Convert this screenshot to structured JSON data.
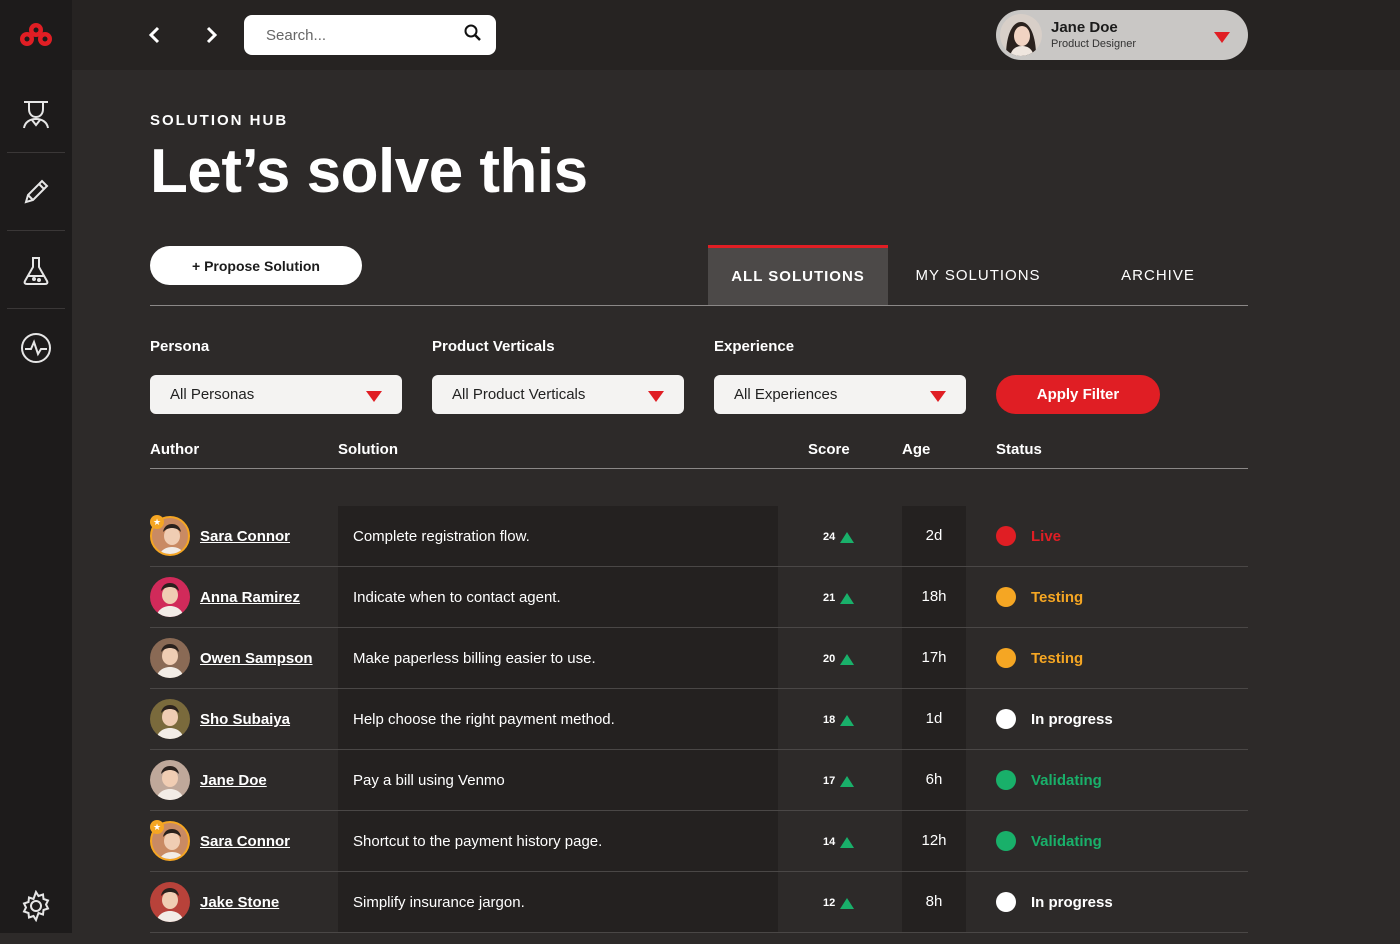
{
  "topbar": {
    "search_placeholder": "Search...",
    "user": {
      "name": "Jane Doe",
      "role": "Product Designer"
    }
  },
  "sidebar": {
    "items": [
      {
        "icon": "logo-icon"
      },
      {
        "icon": "persona-icon"
      },
      {
        "icon": "pencil-icon"
      },
      {
        "icon": "flask-icon"
      },
      {
        "icon": "pulse-icon"
      },
      {
        "icon": "gear-icon"
      }
    ]
  },
  "header": {
    "eyebrow": "SOLUTION HUB",
    "title": "Let’s solve this"
  },
  "actions": {
    "propose_label": "+ Propose Solution"
  },
  "tabs": [
    {
      "label": "ALL SOLUTIONS",
      "active": true
    },
    {
      "label": "MY SOLUTIONS",
      "active": false
    },
    {
      "label": "ARCHIVE",
      "active": false
    }
  ],
  "filters": {
    "persona": {
      "label": "Persona",
      "value": "All Personas"
    },
    "product": {
      "label": "Product Verticals",
      "value": "All Product Verticals"
    },
    "experience": {
      "label": "Experience",
      "value": "All Experiences"
    },
    "apply_label": "Apply Filter"
  },
  "table": {
    "headers": {
      "author": "Author",
      "solution": "Solution",
      "score": "Score",
      "age": "Age",
      "status": "Status"
    },
    "rows": [
      {
        "author": "Sara Connor",
        "solution": "Complete registration flow.",
        "score": "24",
        "age": "2d",
        "status": "Live",
        "status_color": "#e01e24",
        "dot_color": "#e01e24",
        "avatar_color": "#c98a63",
        "ring": "#f5a623",
        "starred": true
      },
      {
        "author": "Anna Ramirez",
        "solution": "Indicate when to contact agent.",
        "score": "21",
        "age": "18h",
        "status": "Testing",
        "status_color": "#f5a623",
        "dot_color": "#f5a623",
        "avatar_color": "#d12a5a",
        "ring": "",
        "starred": false
      },
      {
        "author": "Owen Sampson",
        "solution": "Make paperless billing easier to use.",
        "score": "20",
        "age": "17h",
        "status": "Testing",
        "status_color": "#f5a623",
        "dot_color": "#f5a623",
        "avatar_color": "#8a6a55",
        "ring": "",
        "starred": false
      },
      {
        "author": "Sho Subaiya",
        "solution": "Help choose the right payment method.",
        "score": "18",
        "age": "1d",
        "status": "In progress",
        "status_color": "#ffffff",
        "dot_color": "#ffffff",
        "avatar_color": "#7a6a3c",
        "ring": "",
        "starred": false
      },
      {
        "author": "Jane Doe",
        "solution": "Pay a bill using Venmo",
        "score": "17",
        "age": "6h",
        "status": "Validating",
        "status_color": "#19b06a",
        "dot_color": "#19b06a",
        "avatar_color": "#bfa89a",
        "ring": "",
        "starred": false
      },
      {
        "author": "Sara Connor",
        "solution": "Shortcut to the payment history page.",
        "score": "14",
        "age": "12h",
        "status": "Validating",
        "status_color": "#19b06a",
        "dot_color": "#19b06a",
        "avatar_color": "#c98a63",
        "ring": "#f5a623",
        "starred": true
      },
      {
        "author": "Jake Stone",
        "solution": "Simplify insurance jargon.",
        "score": "12",
        "age": "8h",
        "status": "In progress",
        "status_color": "#ffffff",
        "dot_color": "#ffffff",
        "avatar_color": "#b8423a",
        "ring": "",
        "starred": false
      }
    ]
  },
  "colors": {
    "accent": "#e01e24",
    "up_arrow": "#19b06a"
  }
}
